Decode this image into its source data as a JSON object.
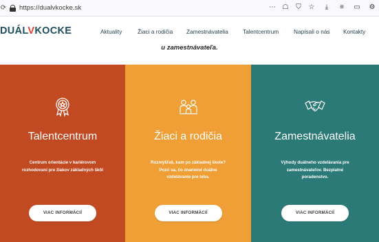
{
  "browser": {
    "url": "https://dualvkocke.sk",
    "reload_icon": "reload-icon",
    "lock_icon": "lock-icon",
    "url_actions": [
      "more-icon",
      "pocket-icon",
      "shield-icon",
      "star-icon"
    ],
    "toolbar_icons": [
      "download-icon",
      "library-icon",
      "sidebar-icon",
      "extensions-icon"
    ]
  },
  "site": {
    "logo": {
      "part1": "DUÁL",
      "v": "V",
      "part2": "KOCKE"
    },
    "nav": [
      "Aktuality",
      "Žiaci a rodičia",
      "Zamestnávatelia",
      "Talentcentrum",
      "Napísali o nás",
      "Kontakty"
    ],
    "intro": "u zamestnávateľa."
  },
  "cards": [
    {
      "title": "Talentcentrum",
      "icon": "badge-star-icon",
      "description": "Centrum orientácie v kariérovom rozhodovaní pre žiakov základných škôl",
      "button": "VIAC INFORMÁCIÍ",
      "color": "#c14a22"
    },
    {
      "title": "Žiaci a rodičia",
      "icon": "family-icon",
      "description": "Rozmýšľaš, kam po základnej škole? Pozri sa, čo znamené duálne vzdelávanie pre teba.",
      "button": "VIAC INFORMÁCIÍ",
      "color": "#ef9f35"
    },
    {
      "title": "Zamestnávatelia",
      "icon": "handshake-icon",
      "description": "Výhody duálneho vzdelávania pre zamestnávateľov. Bezplatné poradenstvo.",
      "button": "VIAC INFORMÁCIÍ",
      "color": "#2b7a78"
    }
  ]
}
